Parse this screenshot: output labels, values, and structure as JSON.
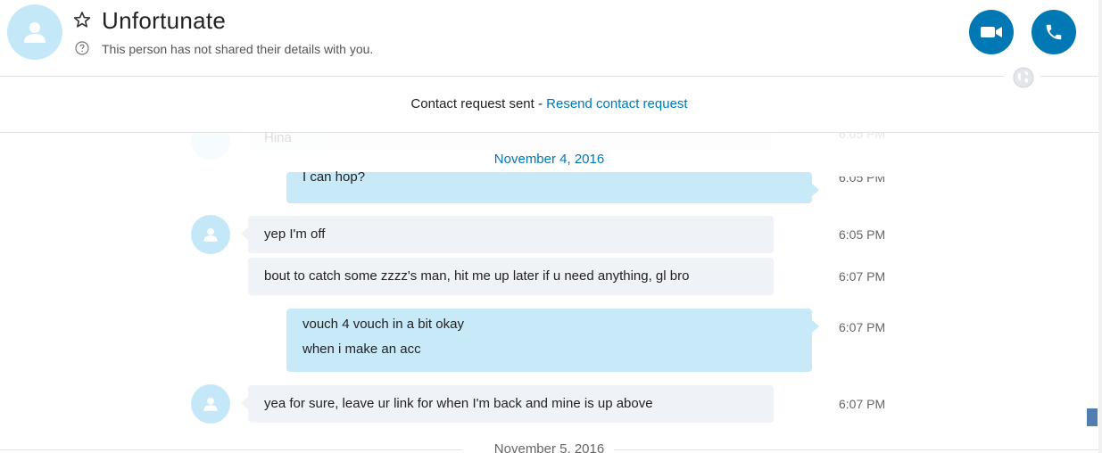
{
  "header": {
    "contact_name": "Unfortunate",
    "subtitle": "This person has not shared their details with you."
  },
  "request_bar": {
    "text": "Contact request sent - ",
    "link": "Resend contact request"
  },
  "chat": {
    "date_top": "November 4, 2016",
    "date_bottom": "November 5, 2016",
    "faded_top": {
      "text": "Hina",
      "time": "6:05 PM"
    },
    "messages": [
      {
        "direction": "outgoing",
        "lines": [
          "I can hop?"
        ],
        "time": "6:05 PM"
      },
      {
        "direction": "incoming",
        "lines": [
          "yep I'm off"
        ],
        "time": "6:05 PM"
      },
      {
        "direction": "incoming",
        "lines": [
          "bout to catch some zzzz's man, hit me up later if u need anything, gl bro"
        ],
        "time": "6:07 PM"
      },
      {
        "direction": "outgoing",
        "lines": [
          "vouch 4 vouch in a bit okay",
          "when i make an acc"
        ],
        "time": "6:07 PM"
      },
      {
        "direction": "incoming",
        "lines": [
          "yea for sure, leave ur link for when I'm back and mine is up above"
        ],
        "time": "6:07 PM"
      }
    ]
  },
  "colors": {
    "accent": "#0078b4",
    "avatar_bg": "#c5e8f8",
    "incoming_bubble": "#eff2f6",
    "outgoing_bubble": "#c7e9f8"
  },
  "icons": [
    "person-icon",
    "star-icon",
    "help-icon",
    "video-icon",
    "phone-icon",
    "globe-icon"
  ]
}
